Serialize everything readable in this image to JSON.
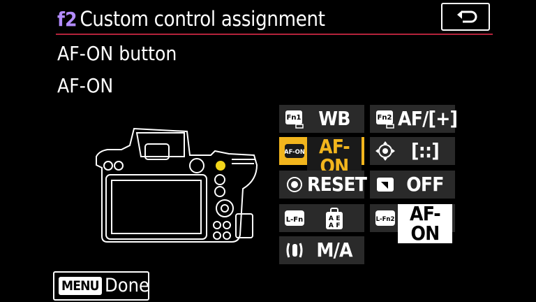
{
  "header": {
    "menu_code": "f2",
    "title": "Custom control assignment",
    "back_icon": "return-arrow-icon"
  },
  "selection": {
    "control": "AF-ON button",
    "value": "AF-ON"
  },
  "grid": [
    {
      "icon": "Fn1",
      "value": "WB",
      "selected": false
    },
    {
      "icon": "Fn2",
      "value": "AF/[+]",
      "selected": false
    },
    {
      "icon": "AF-ON",
      "value": "AF-ON",
      "selected": true
    },
    {
      "icon": "sub-selector-icon",
      "value": "[::]",
      "selected": false
    },
    {
      "icon": "sub-selector-center-icon",
      "value": "RESET",
      "selected": false
    },
    {
      "icon": "movie-record-icon",
      "value": "OFF",
      "selected": false
    },
    {
      "icon": "L-Fn",
      "value": "",
      "selected": false
    },
    {
      "icon": "L-Fn2",
      "value": "AF-ON",
      "selected": false
    },
    {
      "icon": "control-ring-icon",
      "value": "M/A",
      "selected": false
    }
  ],
  "footer": {
    "menu_badge": "MENU",
    "done_label": "Done"
  },
  "colors": {
    "accent_purple": "#b38cff",
    "rule_red": "#b4233b",
    "highlight": "#f2b51d",
    "cell_bg": "#2a2a2a"
  }
}
